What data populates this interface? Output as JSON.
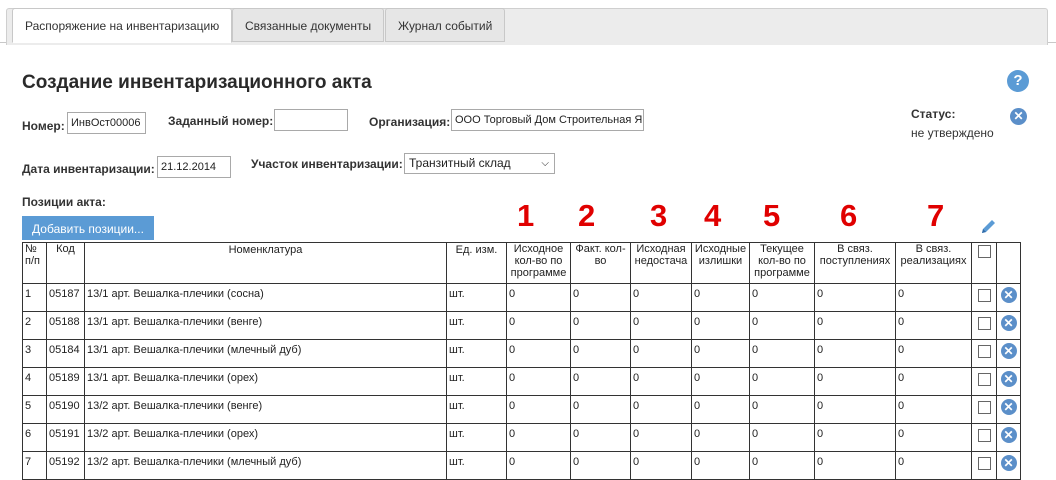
{
  "tabs": [
    {
      "label": "Распоряжение на инвентаризацию"
    },
    {
      "label": "Связанные документы"
    },
    {
      "label": "Журнал событий"
    }
  ],
  "page_title": "Создание инвентаризационного акта",
  "form": {
    "number_label": "Номер:",
    "number_value": "ИнвОст00006",
    "assigned_label": "Заданный номер:",
    "assigned_value": "",
    "org_label": "Организация:",
    "org_value": "ООО Торговый Дом Строительная Я",
    "status_label": "Статус:",
    "status_value": "не утверждено",
    "date_label": "Дата инвентаризации:",
    "date_value": "21.12.2014",
    "area_label": "Участок инвентаризации:",
    "area_value": "Транзитный склад",
    "positions_label": "Позиции акта:",
    "add_button": "Добавить позиции..."
  },
  "annotations": [
    "1",
    "2",
    "3",
    "4",
    "5",
    "6",
    "7"
  ],
  "table": {
    "headers": [
      "№ п/п",
      "Код",
      "Номенклатура",
      "Ед. изм.",
      "Исходное кол-во по программе",
      "Факт. кол-во",
      "Исходная недостача",
      "Исходные излишки",
      "Текущее кол-во по программе",
      "В связ. поступлениях",
      "В связ. реализациях"
    ],
    "rows": [
      [
        "1",
        "05187",
        "13/1 арт. Вешалка-плечики (сосна)",
        "шт.",
        "0",
        "0",
        "0",
        "0",
        "0",
        "0",
        "0"
      ],
      [
        "2",
        "05188",
        "13/1 арт. Вешалка-плечики (венге)",
        "шт.",
        "0",
        "0",
        "0",
        "0",
        "0",
        "0",
        "0"
      ],
      [
        "3",
        "05184",
        "13/1 арт. Вешалка-плечики (млечный дуб)",
        "шт.",
        "0",
        "0",
        "0",
        "0",
        "0",
        "0",
        "0"
      ],
      [
        "4",
        "05189",
        "13/1 арт. Вешалка-плечики (орех)",
        "шт.",
        "0",
        "0",
        "0",
        "0",
        "0",
        "0",
        "0"
      ],
      [
        "5",
        "05190",
        "13/2 арт. Вешалка-плечики (венге)",
        "шт.",
        "0",
        "0",
        "0",
        "0",
        "0",
        "0",
        "0"
      ],
      [
        "6",
        "05191",
        "13/2 арт. Вешалка-плечики (орех)",
        "шт.",
        "0",
        "0",
        "0",
        "0",
        "0",
        "0",
        "0"
      ],
      [
        "7",
        "05192",
        "13/2 арт. Вешалка-плечики (млечный дуб)",
        "шт.",
        "0",
        "0",
        "0",
        "0",
        "0",
        "0",
        "0"
      ]
    ]
  },
  "colors": {
    "accent": "#5b9bd5",
    "annotation": "#e00000"
  }
}
